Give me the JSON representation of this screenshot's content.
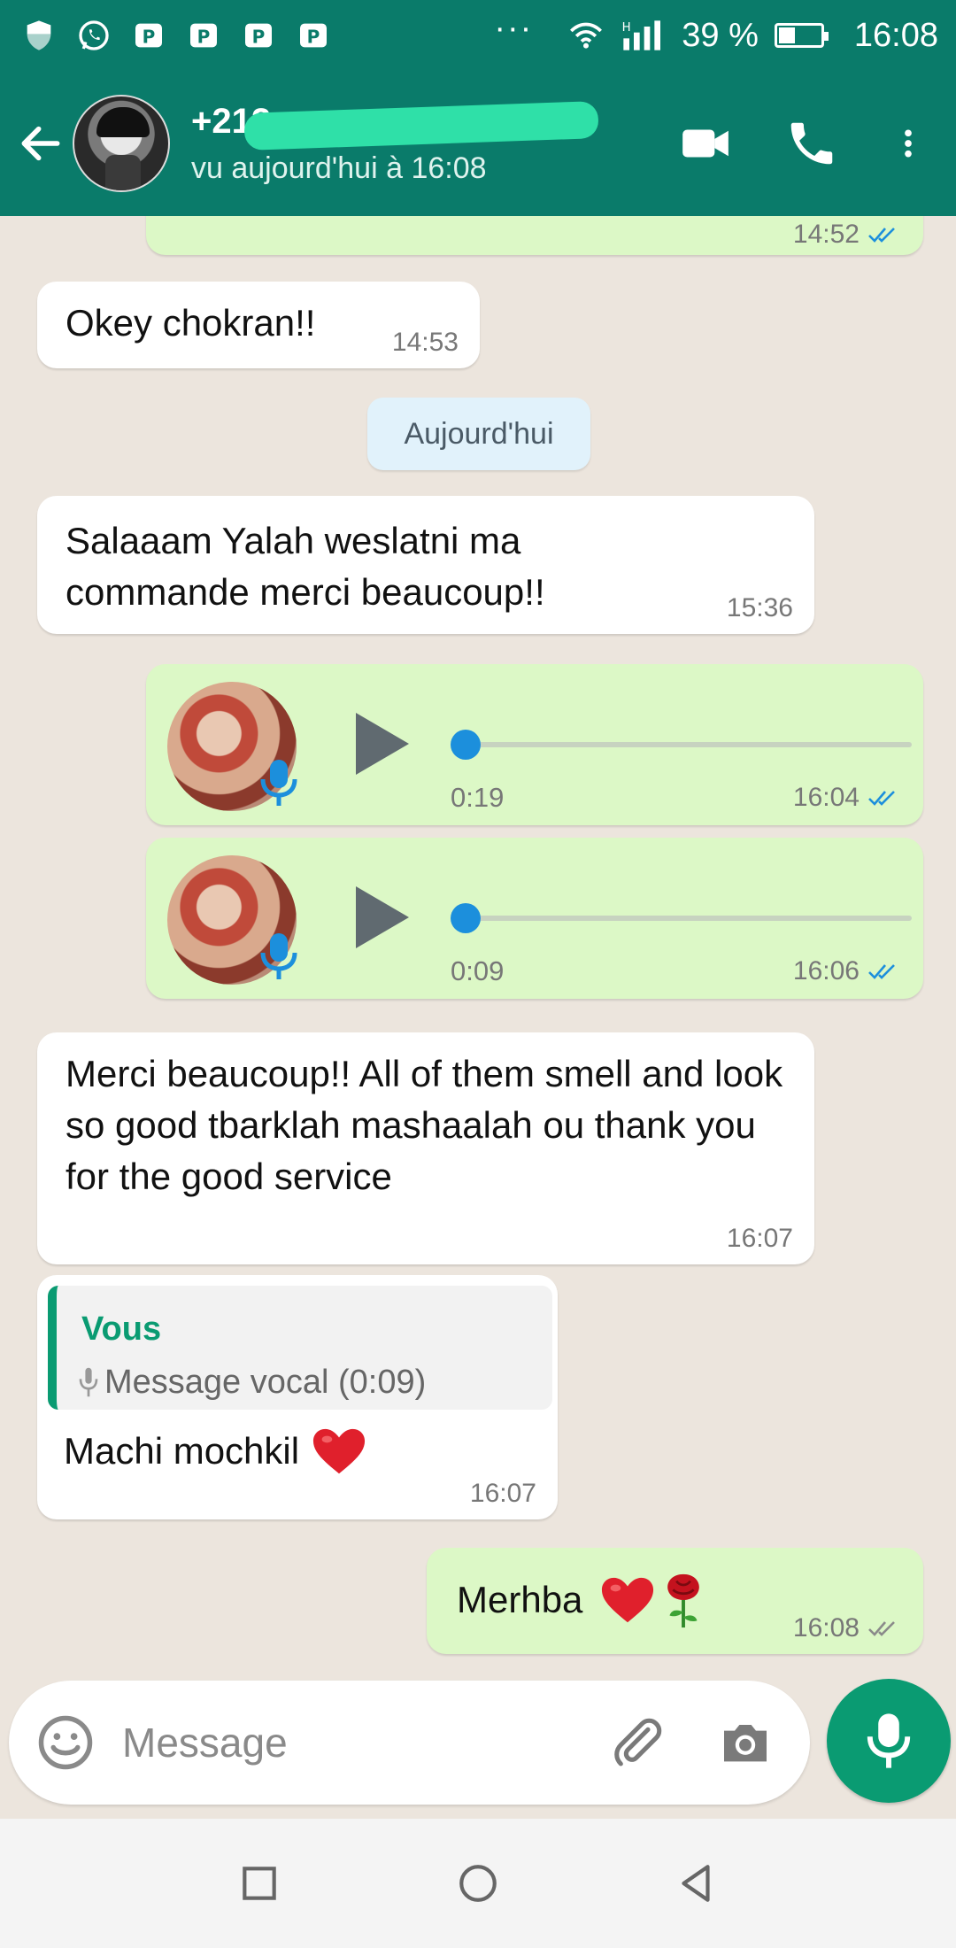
{
  "status_bar": {
    "signal_label": "H",
    "battery_text": "39 %",
    "battery_level": 0.39,
    "time": "16:08",
    "overflow_dots": "···"
  },
  "header": {
    "contact_name": "+212",
    "contact_status": "vu aujourd'hui à 16:08"
  },
  "messages": {
    "partial_out": {
      "time": "14:52"
    },
    "okey": {
      "text": "Okey chokran!!",
      "time": "14:53"
    },
    "date_separator": "Aujourd'hui",
    "salaam": {
      "text": "Salaaam Yalah weslatni ma commande merci beaucoup!!",
      "time": "15:36"
    },
    "voice1": {
      "duration": "0:19",
      "time": "16:04"
    },
    "voice2": {
      "duration": "0:09",
      "time": "16:06"
    },
    "merci": {
      "text": "Merci beaucoup!! All of them smell and look so good tbarklah mashaalah ou thank you for the good service",
      "time": "16:07"
    },
    "reply": {
      "quote_author": "Vous",
      "quote_text": "Message vocal (0:09)",
      "text": "Machi mochkil",
      "time": "16:07"
    },
    "merhba": {
      "text": "Merhba",
      "time": "16:08"
    }
  },
  "input": {
    "placeholder": "Message"
  },
  "colors": {
    "header": "#0a7b6a",
    "chat_bg": "#ece5dd",
    "outgoing": "#dcf8c6",
    "incoming": "#ffffff",
    "accent": "#0a9b72",
    "read_ticks": "#1c8fdc"
  },
  "icons": {
    "status_left": [
      "shield-icon",
      "whatsapp-icon",
      "app-badge-icon",
      "app-badge-icon",
      "app-badge-icon",
      "app-badge-icon"
    ],
    "status_right": [
      "wifi-icon",
      "signal-icon",
      "battery-icon"
    ],
    "header": [
      "back-arrow-icon",
      "video-call-icon",
      "phone-icon",
      "more-vert-icon"
    ],
    "input": [
      "emoji-icon",
      "paperclip-icon",
      "camera-icon",
      "mic-icon"
    ],
    "nav": [
      "square-icon",
      "circle-icon",
      "triangle-back-icon"
    ]
  }
}
